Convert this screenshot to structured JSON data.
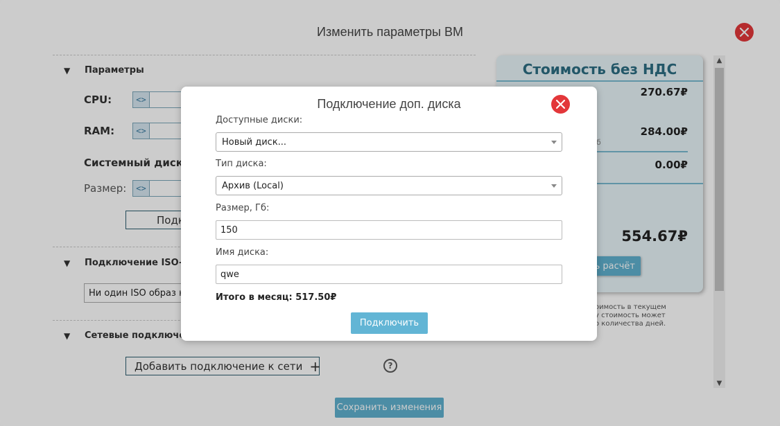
{
  "window": {
    "title": "Изменить параметры ВМ",
    "save_label": "Сохранить изменения"
  },
  "params": {
    "header": "Параметры",
    "cpu_label": "CPU:",
    "ram_label": "RAM:",
    "system_disk_label": "Системный диск:",
    "size_label": "Размер:",
    "connect_disk_btn_partial": "Подк"
  },
  "iso": {
    "header": "Подключение ISO-",
    "select_value": "Ни один ISO образ н"
  },
  "network": {
    "header": "Сетевые подключе",
    "add_label": "Добавить подключение к сети",
    "add_icon": "+",
    "help_icon": "?"
  },
  "cost": {
    "title": "Стоимость без НДС",
    "val1": "270.67₽",
    "val2": "284.00₽",
    "val2_unit_fragment": "б",
    "val3": "0.00₽",
    "total": "554.67₽",
    "recalc_partial": "ь расчёт",
    "note": "оимость в текущем\nу стоимость может\nо количества дней."
  },
  "modal": {
    "title": "Подключение доп. диска",
    "available_label": "Доступные диски:",
    "available_value": "Новый диск...",
    "type_label": "Тип диска:",
    "type_value": "Архив (Local)",
    "size_label": "Размер, Гб:",
    "size_value": "150",
    "name_label": "Имя диска:",
    "name_value": "qwe",
    "total": "Итого в месяц: 517.50₽",
    "connect_label": "Подключить"
  },
  "colors": {
    "accent": "#5fb1cf",
    "close": "#e3373a",
    "cost_title": "#2c6d82"
  }
}
